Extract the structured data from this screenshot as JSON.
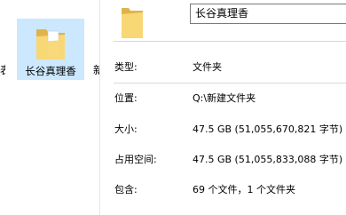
{
  "explorer": {
    "cut_left_text": "表",
    "selected_folder_name": "长谷真理香",
    "cut_right_text": "新"
  },
  "properties": {
    "name_value": "长谷真理香",
    "type_label": "类型:",
    "type_value": "文件夹",
    "location_label": "位置:",
    "location_value": "Q:\\新建文件夹",
    "size_label": "大小:",
    "size_value": "47.5 GB (51,055,670,821 字节)",
    "size_on_disk_label": "占用空间:",
    "size_on_disk_value": "47.5 GB (51,055,833,088 字节)",
    "contains_label": "包含:",
    "contains_value": "69 个文件，1 个文件夹"
  },
  "colors": {
    "selection_bg": "#cce8ff",
    "folder_body": "#f8d775",
    "folder_back": "#e0b34a"
  }
}
